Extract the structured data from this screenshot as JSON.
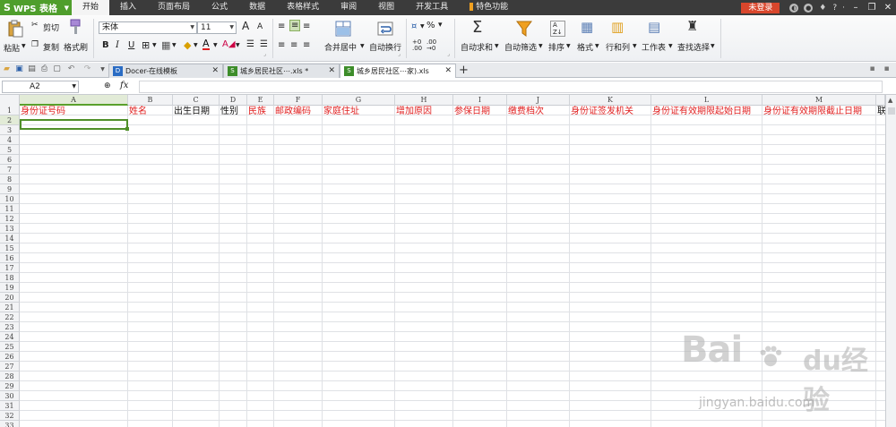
{
  "app": {
    "name": "WPS 表格",
    "menu_tabs": [
      "开始",
      "插入",
      "页面布局",
      "公式",
      "数据",
      "表格样式",
      "审阅",
      "视图",
      "开发工具",
      "特色功能"
    ],
    "active_menu": "开始",
    "login_label": "未登录",
    "help_label": "?",
    "colors": {
      "menubar": "#3b3b3b",
      "app_button": "#4f9e2c",
      "login": "#d9462c",
      "header_text": "#e02020"
    }
  },
  "ribbon": {
    "paste": "粘贴",
    "cut": "剪切",
    "copy": "复制",
    "format_painter": "格式刷",
    "font_name": "宋体",
    "font_size": "11",
    "bold": "B",
    "italic": "I",
    "underline": "U",
    "increase_font": "A",
    "decrease_font": "A",
    "merge_center": "合并居中",
    "wrap_text": "自动换行",
    "percent": "%",
    "autosum": "自动求和",
    "autofilter": "自动筛选",
    "sort": "排序",
    "format": "格式",
    "row_col": "行和列",
    "worksheet": "工作表",
    "find_select": "查找选择"
  },
  "doc_tabs": [
    {
      "label": "Docer-在线模板",
      "icon": "D"
    },
    {
      "label": "城乡居民社区⋯.xls *",
      "icon": "S"
    },
    {
      "label": "城乡居民社区⋯家).xls",
      "icon": "S"
    }
  ],
  "formula_bar": {
    "name_box": "A2",
    "fx": "fx",
    "formula": ""
  },
  "sheet": {
    "columns": [
      "A",
      "B",
      "C",
      "D",
      "E",
      "F",
      "G",
      "H",
      "I",
      "J",
      "K",
      "L",
      "M"
    ],
    "selected_column": "A",
    "rows": [
      "1",
      "2",
      "3",
      "4",
      "5",
      "6",
      "7",
      "8",
      "9",
      "10",
      "11",
      "12",
      "13",
      "14",
      "15",
      "16",
      "17",
      "18",
      "19",
      "20",
      "21",
      "22",
      "23",
      "24",
      "25",
      "26",
      "27",
      "28",
      "29",
      "30",
      "31",
      "32",
      "33"
    ],
    "selected_row": "2",
    "header_row": [
      {
        "text": "身份证号码",
        "color": "#e02020"
      },
      {
        "text": "姓名",
        "color": "#e02020"
      },
      {
        "text": "出生日期",
        "color": "#111111"
      },
      {
        "text": "性别",
        "color": "#111111"
      },
      {
        "text": "民族",
        "color": "#e02020"
      },
      {
        "text": "邮政编码",
        "color": "#e02020"
      },
      {
        "text": "家庭住址",
        "color": "#e02020"
      },
      {
        "text": "增加原因",
        "color": "#e02020"
      },
      {
        "text": "参保日期",
        "color": "#e02020"
      },
      {
        "text": "缴费档次",
        "color": "#e02020"
      },
      {
        "text": "身份证签发机关",
        "color": "#e02020"
      },
      {
        "text": "身份证有效期限起始日期",
        "color": "#e02020"
      },
      {
        "text": "身份证有效期限截止日期",
        "color": "#e02020"
      },
      {
        "text": "联",
        "color": "#111111"
      }
    ]
  },
  "watermark": {
    "logo": "Bai",
    "logo2": "du经验",
    "site": "jingyan.baidu.com"
  }
}
